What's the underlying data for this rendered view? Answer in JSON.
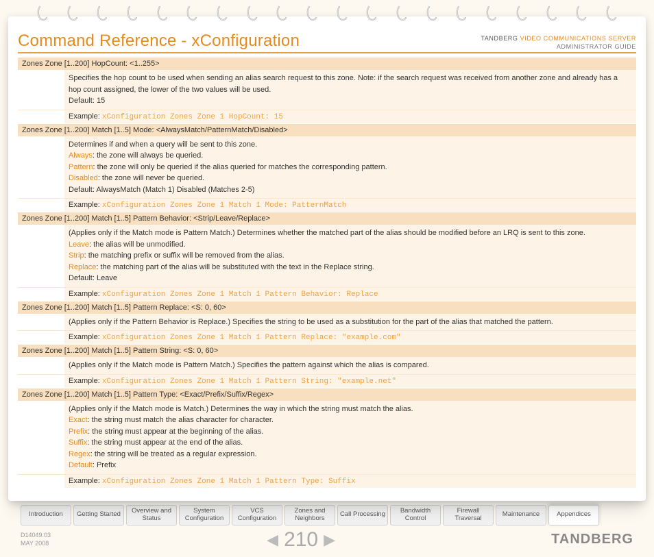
{
  "header": {
    "title": "Command Reference - xConfiguration",
    "brand": "TANDBERG",
    "product": "VIDEO COMMUNICATIONS SERVER",
    "subtitle": "ADMINISTRATOR GUIDE"
  },
  "sections": [
    {
      "command": "Zones Zone [1..200] HopCount: <1..255>",
      "lines": [
        {
          "t": "p",
          "v": "Specifies the hop count to be used when sending an alias search request to this zone. Note: if the search request was received from another zone and already has a hop count assigned, the lower of the two values will be used."
        },
        {
          "t": "p",
          "v": "Default: 15"
        }
      ],
      "example_label": "Example:",
      "example_code": "xConfiguration Zones Zone 1 HopCount: 15"
    },
    {
      "command": "Zones Zone [1..200] Match [1..5] Mode: <AlwaysMatch/PatternMatch/Disabled>",
      "lines": [
        {
          "t": "p",
          "v": "Determines if and when a query will be sent to this zone."
        },
        {
          "t": "kw",
          "k": "Always",
          "v": ": the zone will always be queried."
        },
        {
          "t": "kw",
          "k": "Pattern",
          "v": ": the zone will only be queried if the alias queried for matches the corresponding pattern."
        },
        {
          "t": "kw",
          "k": "Disabled",
          "v": ": the zone will never be queried."
        },
        {
          "t": "p",
          "v": "Default: AlwaysMatch (Match 1) Disabled (Matches 2-5)"
        }
      ],
      "example_label": "Example:",
      "example_code": "xConfiguration Zones Zone 1 Match 1 Mode: PatternMatch"
    },
    {
      "command": "Zones Zone [1..200] Match [1..5] Pattern Behavior: <Strip/Leave/Replace>",
      "lines": [
        {
          "t": "p",
          "v": "(Applies only if the Match mode is Pattern Match.) Determines whether the matched part of the alias should be modified before an LRQ is sent to this zone."
        },
        {
          "t": "kw",
          "k": "Leave",
          "v": ": the alias will be unmodified."
        },
        {
          "t": "kw",
          "k": "Strip",
          "v": ": the matching prefix or suffix will be removed from the alias."
        },
        {
          "t": "kw",
          "k": "Replace",
          "v": ": the matching part of the alias will be substituted with the text in the Replace string."
        },
        {
          "t": "p",
          "v": "Default: Leave"
        }
      ],
      "example_label": "Example:",
      "example_code": "xConfiguration Zones Zone 1 Match 1 Pattern Behavior: Replace"
    },
    {
      "command": "Zones Zone [1..200] Match [1..5] Pattern Replace: <S: 0, 60>",
      "lines": [
        {
          "t": "p",
          "v": "(Applies only if the Pattern Behavior is Replace.) Specifies the string to be used as a substitution for the part of the alias that matched the pattern."
        }
      ],
      "example_label": "Example:",
      "example_code": "xConfiguration Zones Zone 1 Match 1 Pattern Replace: \"example.com\""
    },
    {
      "command": "Zones Zone [1..200] Match [1..5] Pattern String: <S: 0, 60>",
      "lines": [
        {
          "t": "p",
          "v": "(Applies only if the Match mode is Pattern Match.) Specifies the pattern against which the alias is compared."
        }
      ],
      "example_label": "Example:",
      "example_code": "xConfiguration Zones Zone 1 Match 1 Pattern String: \"example.net\""
    },
    {
      "command": "Zones Zone [1..200] Match [1..5] Pattern Type: <Exact/Prefix/Suffix/Regex>",
      "lines": [
        {
          "t": "p",
          "v": "(Applies only if the Match mode is Match.) Determines the way in which the string must match the alias."
        },
        {
          "t": "kw",
          "k": "Exact",
          "v": ": the string must match the alias character for character."
        },
        {
          "t": "kw",
          "k": "Prefix",
          "v": ": the string must appear at the beginning of the alias."
        },
        {
          "t": "kw",
          "k": "Suffix",
          "v": ": the string must appear at the end of the alias."
        },
        {
          "t": "kw",
          "k": "Regex",
          "v": ": the string will be treated as a regular expression."
        },
        {
          "t": "kw",
          "k": "Default",
          "v": ": Prefix"
        }
      ],
      "example_label": "Example:",
      "example_code": "xConfiguration Zones Zone 1 Match 1 Pattern Type: Suffix"
    }
  ],
  "tabs": [
    {
      "label": "Introduction",
      "active": false
    },
    {
      "label": "Getting Started",
      "active": false
    },
    {
      "label": "Overview and Status",
      "active": false
    },
    {
      "label": "System Configuration",
      "active": false
    },
    {
      "label": "VCS Configuration",
      "active": false
    },
    {
      "label": "Zones and Neighbors",
      "active": false
    },
    {
      "label": "Call Processing",
      "active": false
    },
    {
      "label": "Bandwidth Control",
      "active": false
    },
    {
      "label": "Firewall Traversal",
      "active": false
    },
    {
      "label": "Maintenance",
      "active": false
    },
    {
      "label": "Appendices",
      "active": true
    }
  ],
  "footer": {
    "docnum": "D14049.03",
    "date": "MAY 2008",
    "page": "210",
    "brand": "TANDBERG"
  },
  "ring_count": 20
}
